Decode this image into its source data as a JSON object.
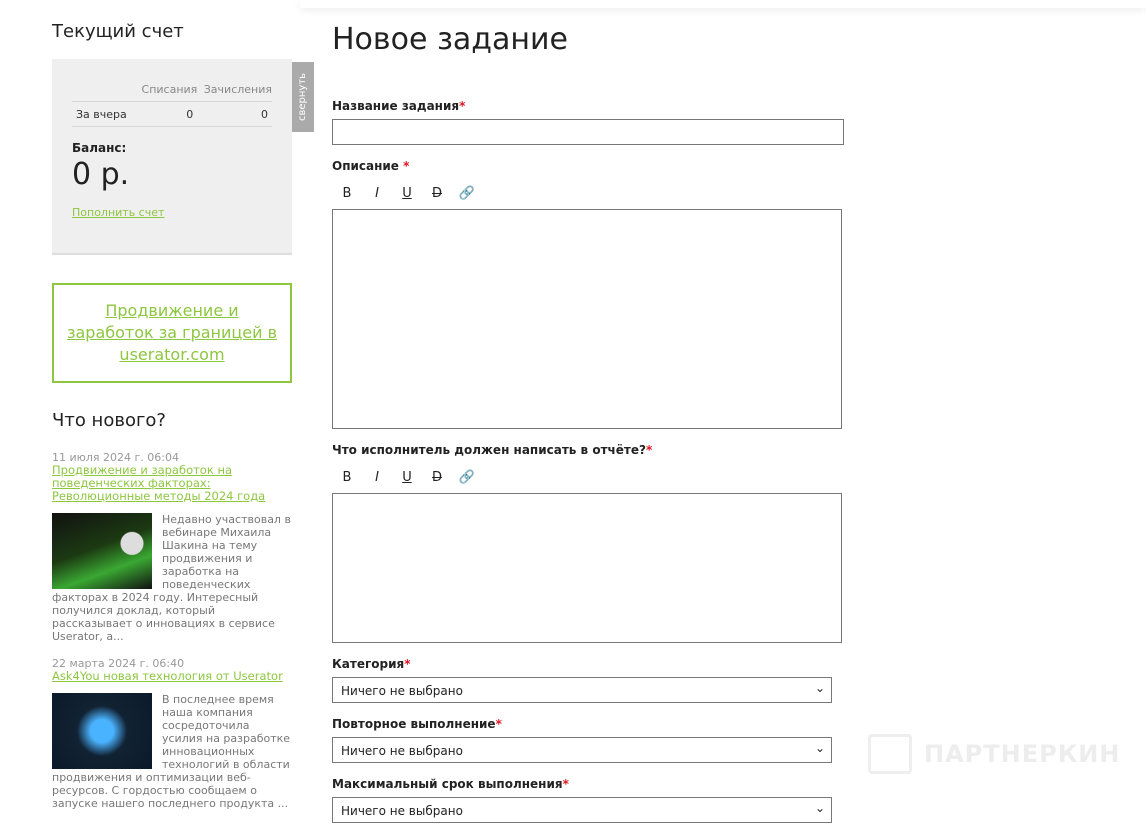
{
  "account": {
    "title": "Текущий счет",
    "col_debit": "Списания",
    "col_credit": "Зачисления",
    "row_label": "За вчера",
    "debit": "0",
    "credit": "0",
    "balance_label": "Баланс:",
    "balance": "0 р.",
    "topup": "Пополнить счет",
    "collapse": "свернуть"
  },
  "promo": "Продвижение и заработок за границей в userator.com",
  "news": {
    "title": "Что нового?",
    "items": [
      {
        "date": "11 июля 2024 г. 06:04",
        "title": "Продвижение и заработок на поведенческих факторах: Революционные методы 2024 года",
        "text": "Недавно участвовал в вебинаре Михаила Шакина на тему продвижения и заработка на поведенческих факторах в 2024 году. Интересный получился доклад, который рассказывает о инновациях в сервисе Userator, а..."
      },
      {
        "date": "22 марта 2024 г. 06:40",
        "title": "Ask4You новая технология от Userator",
        "text": "В последнее время наша компания сосредоточила усилия на разработке инновационных технологий в области продвижения и оптимизации веб-ресурсов. С гордостью сообщаем о запуске нашего последнего продукта ..."
      }
    ]
  },
  "form": {
    "title": "Новое задание",
    "name_label": "Название задания",
    "desc_label": "Описание",
    "report_label": "Что исполнитель должен написать в отчёте?",
    "category_label": "Категория",
    "repeat_label": "Повторное выполнение",
    "deadline_label": "Максимальный срок выполнения",
    "required": "*",
    "select_value": "Ничего не выбрано",
    "toolbar": {
      "bold": "B",
      "italic": "I",
      "underline": "U",
      "strike": "D"
    }
  },
  "watermark": "ПАРТНЕРКИН",
  "colors": {
    "accent": "#8dc63f",
    "required": "#e0141e"
  }
}
